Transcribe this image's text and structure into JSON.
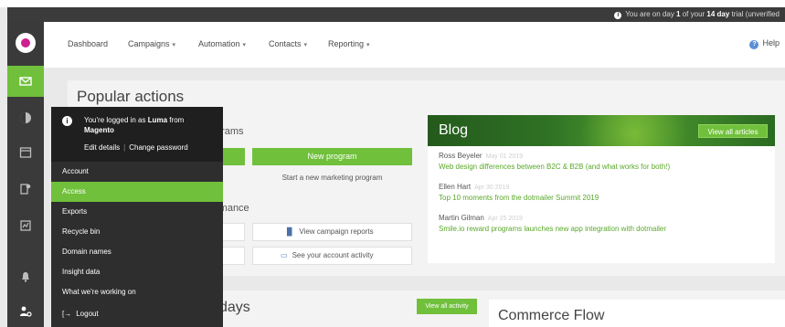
{
  "trial_banner": {
    "prefix": "You are on day ",
    "day": "1",
    "middle": " of your ",
    "length": "14 day",
    "suffix": " trial (unverified"
  },
  "nav": {
    "items": [
      {
        "label": "Dashboard",
        "caret": ""
      },
      {
        "label": "Campaigns",
        "caret": "▾"
      },
      {
        "label": "Automation",
        "caret": "▾"
      },
      {
        "label": "Contacts",
        "caret": "▾"
      },
      {
        "label": "Reporting",
        "caret": "▾"
      }
    ],
    "help": "Help"
  },
  "popular": {
    "title": "Popular actions",
    "programs_fragment": "grams",
    "new_program_button": "New program",
    "start_program_link": "Start a new marketing program",
    "performance_fragment": "rmance",
    "view_reports": "View campaign reports",
    "account_activity": "See your account activity"
  },
  "blog": {
    "title": "Blog",
    "view_all": "View all articles",
    "posts": [
      {
        "author": "Ross Beyeler",
        "date": "May 01 2019",
        "title": "Web design differences between B2C & B2B (and what works for both!)"
      },
      {
        "author": "Ellen Hart",
        "date": "Apr 30 2019",
        "title": "Top 10 moments from the dotmailer Summit 2019"
      },
      {
        "author": "Martin Gilman",
        "date": "Apr 25 2019",
        "title": "Smile.io reward programs launches new app integration with dotmailer"
      }
    ]
  },
  "lower": {
    "days_fragment": "days",
    "view_activity": "View all activity",
    "commerce_title": "Commerce Flow"
  },
  "account_menu": {
    "logged_in_prefix": "You're logged in as ",
    "user": "Luma",
    "from": " from",
    "company": "Magento",
    "edit_details": "Edit details",
    "separator": "|",
    "change_password": "Change password",
    "items": [
      "Account",
      "Access",
      "Exports",
      "Recycle bin",
      "Domain names",
      "Insight data",
      "What we're working on"
    ],
    "logout": "Logout",
    "active_item": "Access"
  },
  "colors": {
    "accent": "#70c03b",
    "sidebar": "#3a3a3a",
    "menu": "#2e2e2e",
    "brand": "#cf1f8e"
  }
}
